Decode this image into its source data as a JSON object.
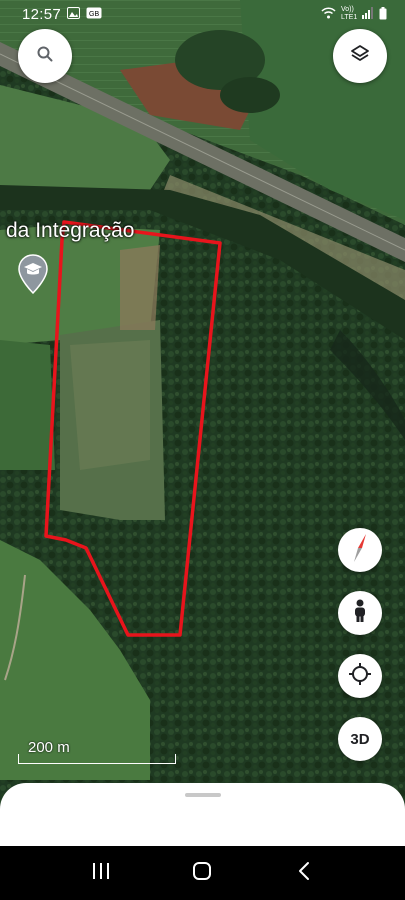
{
  "status_bar": {
    "time": "12:57",
    "network_label": "Vo)) LTE1"
  },
  "map": {
    "place_label": "da Integração",
    "scale_label": "200 m",
    "boundary_color": "#e8141c",
    "imagery": "satellite"
  },
  "controls": {
    "search_icon": "search-icon",
    "layers_icon": "layers-icon",
    "compass_icon": "compass-icon",
    "street_view_icon": "pegman-icon",
    "my_location_icon": "my-location-icon",
    "three_d_label": "3D"
  },
  "nav_bar": {
    "recent_icon": "recent-apps-icon",
    "home_icon": "home-icon",
    "back_icon": "back-icon"
  }
}
